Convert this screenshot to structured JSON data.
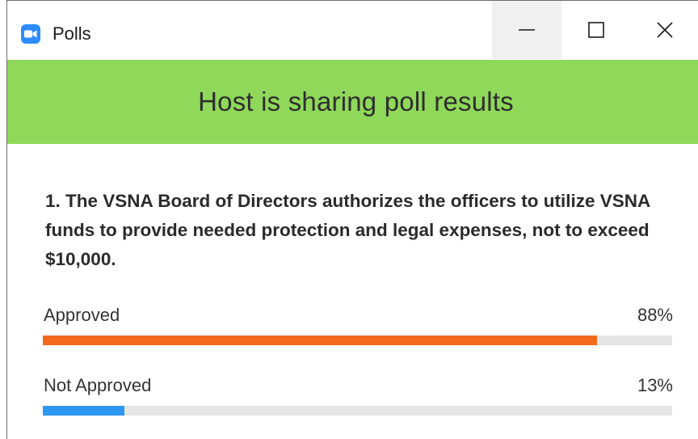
{
  "window": {
    "title": "Polls",
    "app_icon": "zoom-camera-icon"
  },
  "controls": {
    "minimize_icon": "minimize-icon",
    "maximize_icon": "maximize-icon",
    "close_icon": "close-icon"
  },
  "banner": {
    "text": "Host is sharing poll results",
    "color": "#8fd85a"
  },
  "poll": {
    "question": "1. The VSNA Board of Directors authorizes the officers to utilize VSNA funds to provide needed protection and legal expenses, not to exceed $10,000.",
    "options": [
      {
        "label": "Approved",
        "percent_text": "88%",
        "percent": 88,
        "color": "#f26a1b"
      },
      {
        "label": "Not Approved",
        "percent_text": "13%",
        "percent": 13,
        "color": "#2d98f0"
      }
    ]
  }
}
